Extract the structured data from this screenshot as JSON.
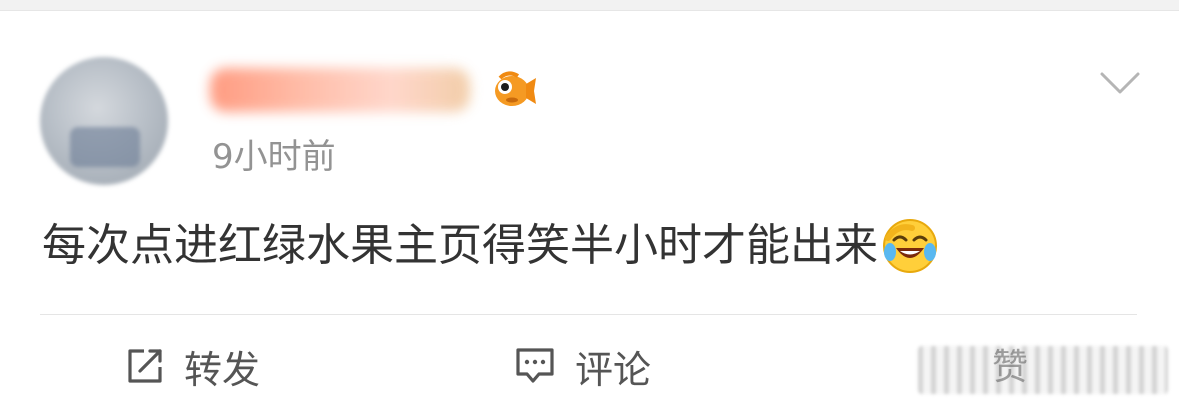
{
  "post": {
    "timestamp": "9小时前",
    "text": "每次点进红绿水果主页得笑半小时才能出来",
    "emoji": "laugh-cry-emoji"
  },
  "actions": {
    "repost_label": "转发",
    "comment_label": "评论",
    "like_label": "赞"
  },
  "icons": {
    "repost": "repost-icon",
    "comment": "comment-icon",
    "more": "chevron-down-icon",
    "badge": "fish-icon"
  },
  "colors": {
    "text_primary": "#333333",
    "text_secondary": "#939393",
    "divider": "#e5e5e5"
  }
}
